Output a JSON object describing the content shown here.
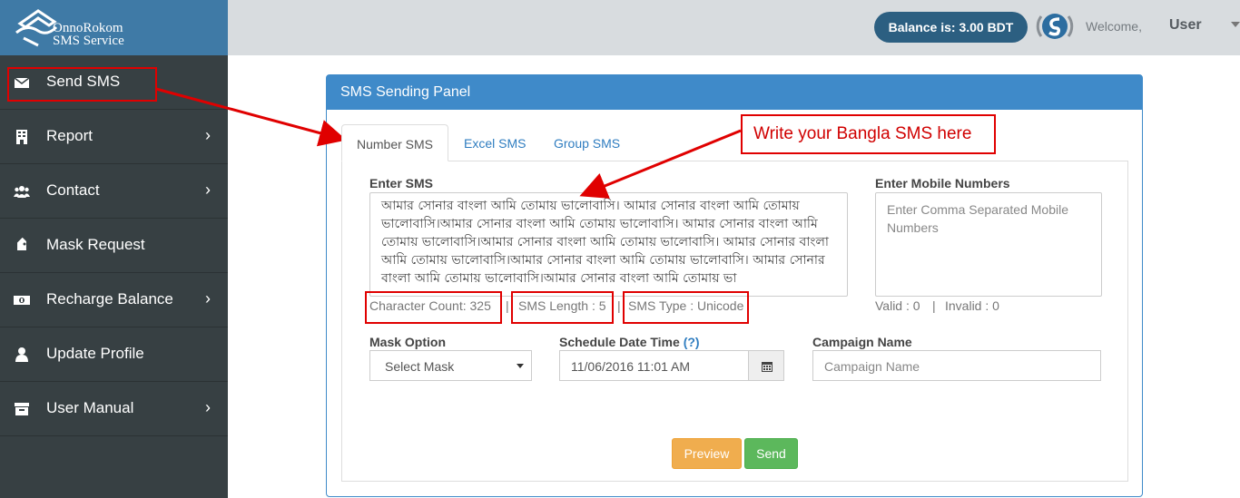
{
  "brand": {
    "line1": "OnnoRokom",
    "line2": "SMS Service"
  },
  "sidebar": {
    "items": [
      {
        "label": "Send SMS",
        "icon": "envelope-icon",
        "has_chevron": false
      },
      {
        "label": "Report",
        "icon": "building-icon",
        "has_chevron": true
      },
      {
        "label": "Contact",
        "icon": "users-icon",
        "has_chevron": true
      },
      {
        "label": "Mask Request",
        "icon": "tag-icon",
        "has_chevron": false
      },
      {
        "label": "Recharge Balance",
        "icon": "money-icon",
        "has_chevron": true
      },
      {
        "label": "Update Profile",
        "icon": "user-icon",
        "has_chevron": false
      },
      {
        "label": "User Manual",
        "icon": "archive-icon",
        "has_chevron": true
      }
    ],
    "chevron": "›"
  },
  "topbar": {
    "balance": "Balance is: 3.00 BDT",
    "welcome": "Welcome,",
    "user": "User"
  },
  "panel": {
    "title": "SMS Sending Panel",
    "tabs": [
      "Number SMS",
      "Excel SMS",
      "Group SMS"
    ],
    "enter_sms_label": "Enter SMS",
    "sms_text": "আমার সোনার বাংলা আমি তোমায় ভালোবাসি। আমার সোনার বাংলা আমি তোমায় ভালোবাসি।আমার সোনার বাংলা আমি তোমায় ভালোবাসি। আমার সোনার বাংলা আমি তোমায় ভালোবাসি।আমার সোনার বাংলা আমি তোমায় ভালোবাসি। আমার সোনার বাংলা আমি তোমায় ভালোবাসি।আমার সোনার বাংলা আমি তোমায় ভালোবাসি। আমার সোনার বাংলা আমি তোমায় ভালোবাসি।আমার সোনার বাংলা আমি তোমায় ভা",
    "char_count": "Character Count: 325",
    "sms_length": "SMS Length : 5",
    "sms_type": "SMS Type : Unicode",
    "mobile_label": "Enter Mobile Numbers",
    "mobile_placeholder": "Enter Comma Separated Mobile Numbers",
    "valid": "Valid : 0",
    "invalid": "Invalid : 0",
    "sep": "|",
    "mask_label": "Mask Option",
    "mask_value": "Select Mask",
    "schedule_label": "Schedule Date Time",
    "schedule_help": "(?)",
    "schedule_value": "11/06/2016 11:01 AM",
    "campaign_label": "Campaign Name",
    "campaign_placeholder": "Campaign Name",
    "preview_btn": "Preview",
    "send_btn": "Send"
  },
  "annotation": {
    "callout": "Write your Bangla SMS here"
  },
  "colors": {
    "sidebar": "#374043",
    "brand": "#3f7aa6",
    "panel_header": "#3f8ac9",
    "annotation": "#e00000"
  }
}
